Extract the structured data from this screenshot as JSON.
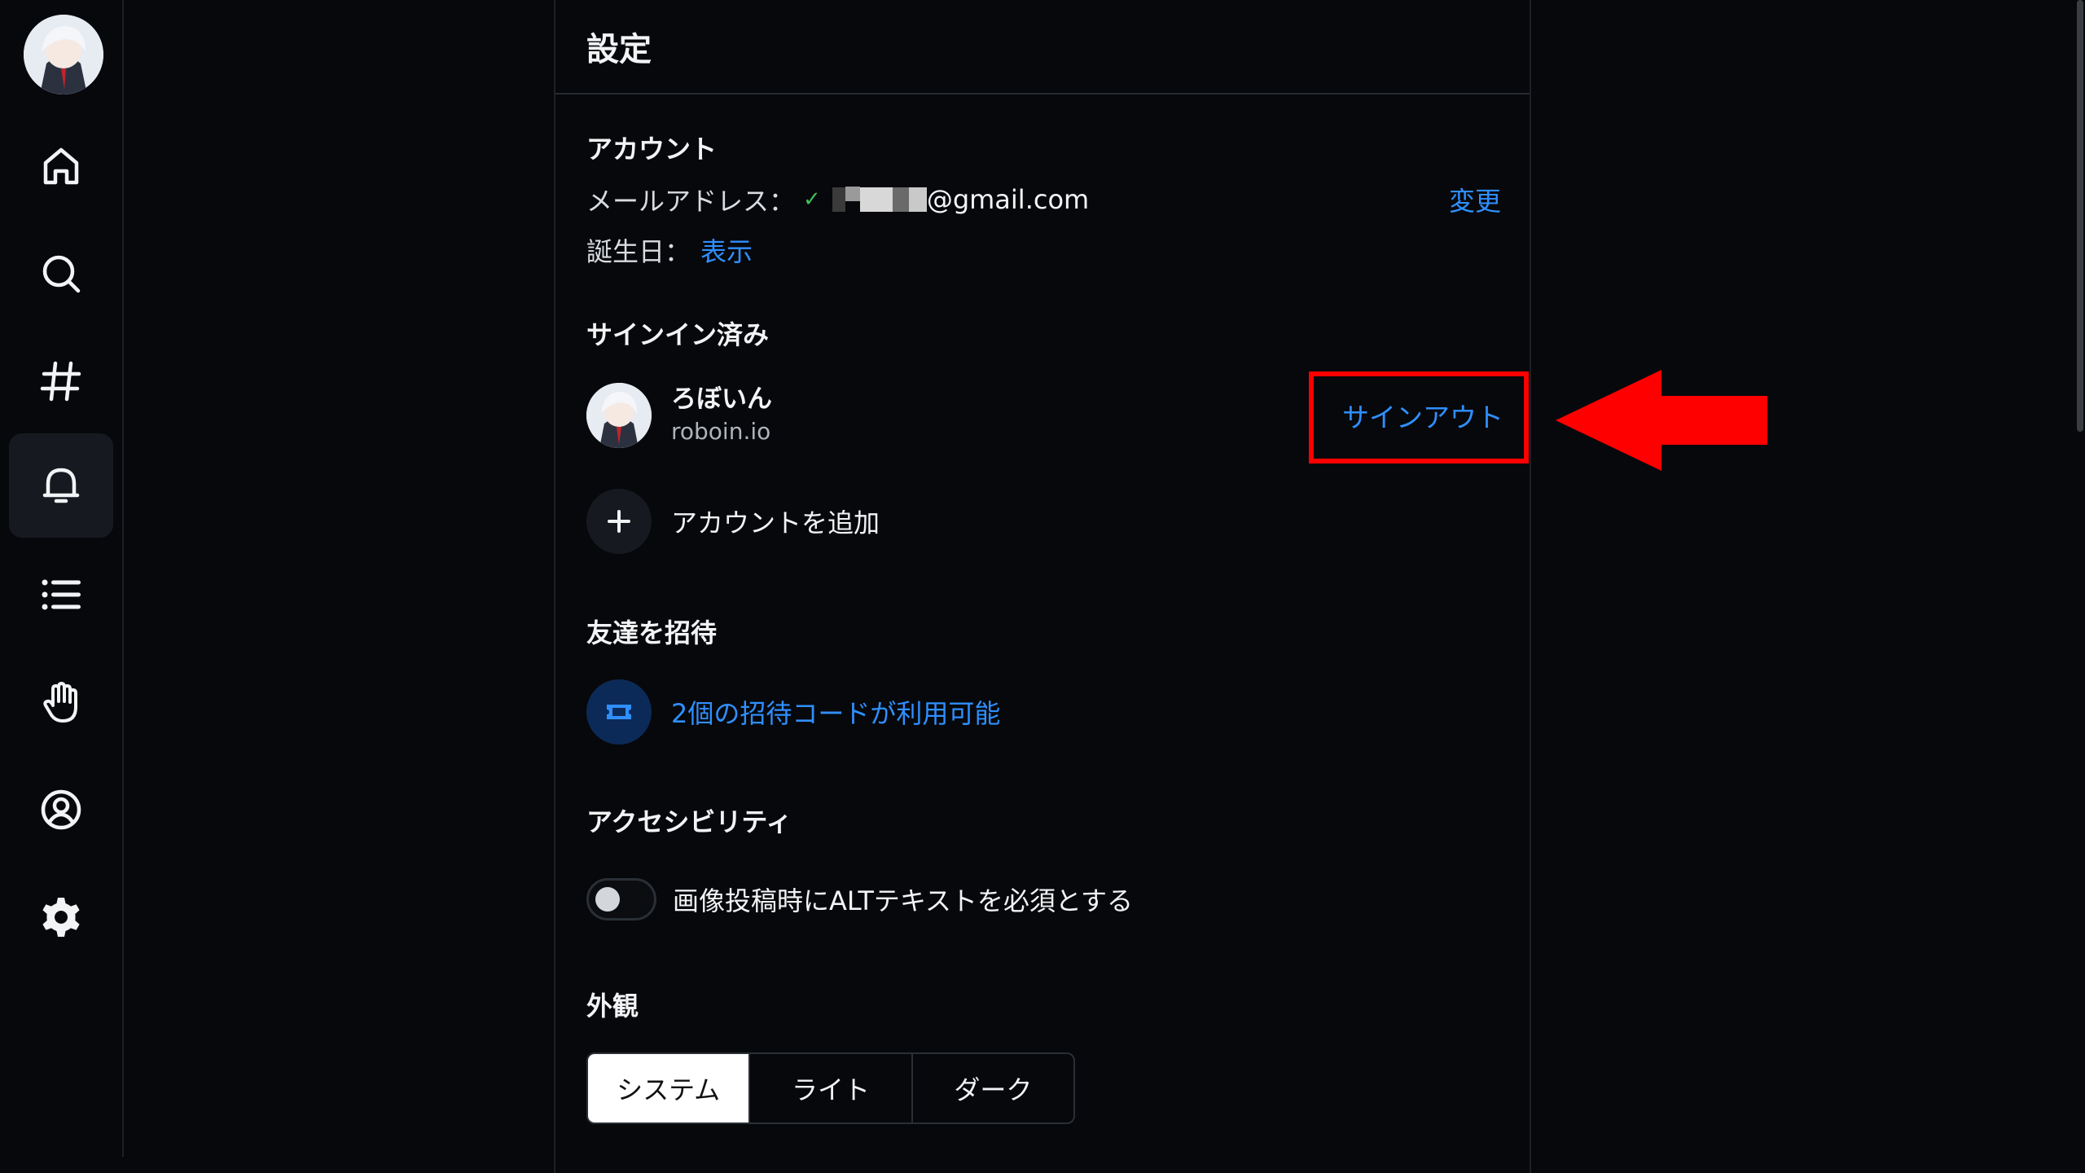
{
  "page": {
    "title": "設定"
  },
  "nav": {
    "items": [
      {
        "id": "home",
        "icon": "home-icon"
      },
      {
        "id": "search",
        "icon": "search-icon"
      },
      {
        "id": "feeds",
        "icon": "hash-icon"
      },
      {
        "id": "notifications",
        "icon": "bell-icon",
        "active": true
      },
      {
        "id": "lists",
        "icon": "list-icon"
      },
      {
        "id": "moderation",
        "icon": "hand-icon"
      },
      {
        "id": "profile",
        "icon": "user-circle-icon"
      },
      {
        "id": "settings",
        "icon": "gear-icon"
      }
    ]
  },
  "account": {
    "title": "アカウント",
    "email_label": "メールアドレス：",
    "email_domain": "@gmail.com",
    "change_label": "変更",
    "birthday_label": "誕生日：",
    "birthday_link": "表示"
  },
  "signed_in": {
    "title": "サインイン済み",
    "display_name": "ろぼいん",
    "handle": "roboin.io",
    "sign_out_label": "サインアウト",
    "add_account_label": "アカウントを追加"
  },
  "invite": {
    "title": "友達を招待",
    "codes_label": "2個の招待コードが利用可能"
  },
  "accessibility": {
    "title": "アクセシビリティ",
    "alt_text_label": "画像投稿時にALTテキストを必須とする",
    "alt_text_enabled": false
  },
  "appearance": {
    "title": "外観",
    "options": [
      "システム",
      "ライト",
      "ダーク"
    ],
    "selected": "システム"
  },
  "colors": {
    "link": "#2f8fff",
    "annotation": "#ff0000",
    "background": "#07080b"
  }
}
